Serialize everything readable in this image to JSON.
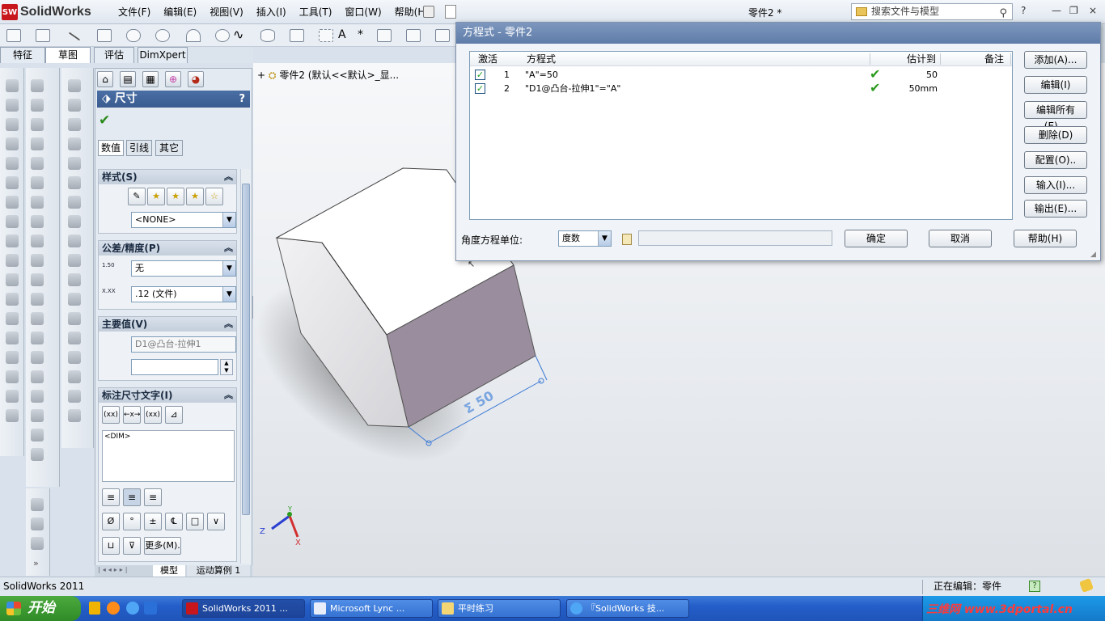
{
  "app": {
    "name": "SolidWorks",
    "logo_badge": "SW",
    "doc_title": "零件2 *"
  },
  "menu": [
    "文件(F)",
    "编辑(E)",
    "视图(V)",
    "插入(I)",
    "工具(T)",
    "窗口(W)",
    "帮助(H)"
  ],
  "search": {
    "placeholder": "搜索文件与模型"
  },
  "window_controls": {
    "help": "?",
    "minimize": "—",
    "restore": "❐",
    "close": "×"
  },
  "main_tabs": [
    "特征",
    "草图",
    "评估",
    "DimXpert"
  ],
  "active_main_tab": "草图",
  "property_manager": {
    "title": "尺寸",
    "help": "?",
    "subtabs": [
      "数值",
      "引线",
      "其它"
    ],
    "active_subtab": "数值",
    "style": {
      "title": "样式(S)",
      "combo": "<NONE>"
    },
    "tolerance": {
      "title": "公差/精度(P)",
      "tolerance_type": "无",
      "precision": ".12 (文件)",
      "tol_icon_label": "1.50",
      "prec_icon_label": "X.XX"
    },
    "primary_value": {
      "title": "主要值(V)",
      "name": "D1@凸台-拉伸1",
      "value": ""
    },
    "dim_text": {
      "title": "标注尺寸文字(I)",
      "text": "<DIM>",
      "buttons": [
        "(xx)",
        "←x→",
        "(xx)",
        "⊿"
      ],
      "symbols": [
        "Ø",
        "°",
        "±",
        "℄",
        "□",
        "∨",
        "⊔",
        "⊽"
      ],
      "more": "更多(M)."
    }
  },
  "bottom_tabs": [
    "模型",
    "运动算例 1"
  ],
  "tree": {
    "expand": "+",
    "text": "零件2  (默认<<默认>_显..."
  },
  "dimension_label": "Σ 50",
  "triad": {
    "x": "X",
    "y": "Y",
    "z": "Z"
  },
  "dialog": {
    "title": "方程式 - 零件2",
    "columns": [
      "激活",
      "方程式",
      "估计到",
      "备注"
    ],
    "rows": [
      {
        "active": true,
        "index": "1",
        "equation": "\"A\"=50",
        "evaluates": "50",
        "note": ""
      },
      {
        "active": true,
        "index": "2",
        "equation": "\"D1@凸台-拉伸1\"=\"A\"",
        "evaluates": "50mm",
        "note": ""
      }
    ],
    "side_buttons": [
      "添加(A)...",
      "编辑(I)",
      "编辑所有(E)...",
      "删除(D)",
      "配置(O)..",
      "输入(I)...",
      "输出(E)..."
    ],
    "angle_unit_label": "角度方程单位:",
    "angle_unit_value": "度数",
    "ok": "确定",
    "cancel": "取消",
    "help": "帮助(H)"
  },
  "status": {
    "left": "SolidWorks 2011",
    "editing": "正在编辑：零件"
  },
  "taskbar": {
    "start": "开始",
    "tasks": [
      "SolidWorks 2011 ...",
      "Microsoft Lync  ...",
      "平时练习",
      "『SolidWorks 技..."
    ],
    "watermark": "三维网 www.3dportal.cn"
  },
  "colors": {
    "title_blue": "#5f7ca9",
    "pm_header": "#3a5c8f",
    "check_green": "#2c9a1e",
    "part_front": "#9a8d9d",
    "taskbar": "#245ec9",
    "start_green": "#2f8b26",
    "sw_red": "#c8161d"
  }
}
